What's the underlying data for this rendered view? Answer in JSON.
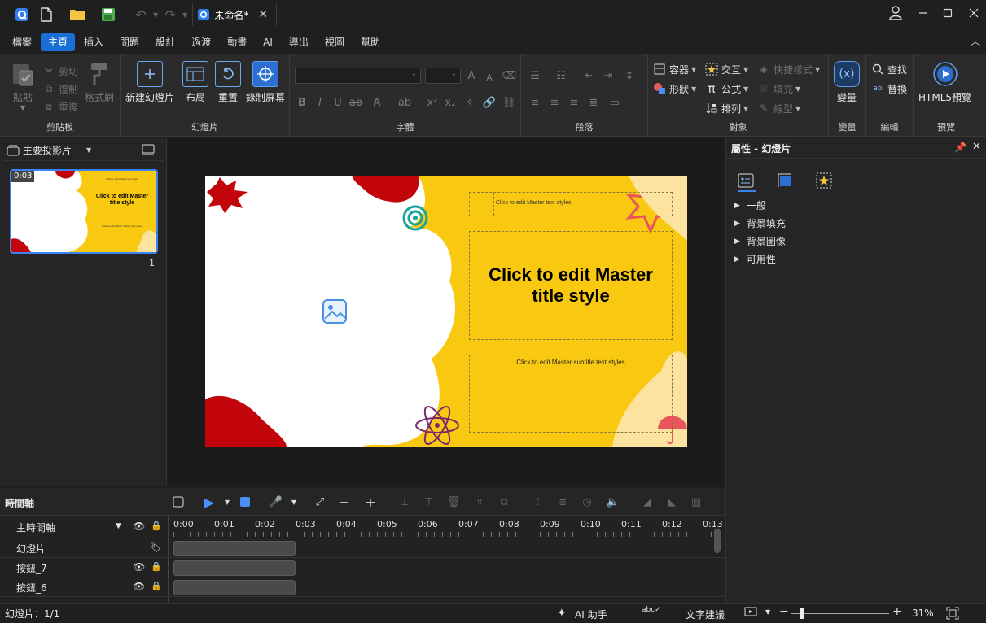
{
  "app": {
    "tab_title": "未命名*"
  },
  "menu": [
    "檔案",
    "主頁",
    "插入",
    "問題",
    "設計",
    "過渡",
    "動畫",
    "AI",
    "導出",
    "視圖",
    "幫助"
  ],
  "ribbon": {
    "clipboard": {
      "paste": "貼貼",
      "cut": "剪切",
      "copy": "復制",
      "redo": "重復",
      "format_painter": "格式刷",
      "label": "剪貼板"
    },
    "slides": {
      "new_slide": "新建幻燈片",
      "layout": "布局",
      "reset": "重置",
      "record_screen": "錄制屏幕",
      "label": "幻燈片"
    },
    "font": {
      "label": "字體"
    },
    "paragraph": {
      "label": "段落"
    },
    "object": {
      "container": "容器",
      "shape": "形狀",
      "interaction": "交互",
      "formula": "公式",
      "arrange": "排列",
      "quick_style": "快捷樣式",
      "fill": "填充",
      "line_type": "線型",
      "label": "對象"
    },
    "variable": {
      "variable": "變量",
      "label": "變量"
    },
    "edit": {
      "find": "查找",
      "replace": "替換",
      "label": "編輯"
    },
    "preview": {
      "html5_preview": "HTML5預覽",
      "label": "預覽"
    }
  },
  "left_panel": {
    "master_slide": "主要投影片",
    "thumb_duration": "0:03",
    "thumb_title": "Click to edit Master title style",
    "thumb_text": "Click to edit Master text styles",
    "thumb_subtitle": "Click to edit Master subtitle text styles",
    "thumb_number": "1"
  },
  "slide": {
    "text_styles": "Click to edit Master text styles",
    "title": "Click to edit Master title style",
    "subtitle": "Click to edit Master subtitle text styles"
  },
  "colors": {
    "accent": "#1a6fd6",
    "slide_bg": "#f9c912",
    "slide_red": "#c1050b",
    "selection": "#3b82f6"
  },
  "properties": {
    "title": "屬性 - 幻燈片",
    "sections": [
      "一般",
      "背景填充",
      "背景圖像",
      "可用性"
    ]
  },
  "timeline": {
    "title": "時間軸",
    "main": "主時間軸",
    "ticks": [
      "0:00",
      "0:01",
      "0:02",
      "0:03",
      "0:04",
      "0:05",
      "0:06",
      "0:07",
      "0:08",
      "0:09",
      "0:10",
      "0:11",
      "0:12",
      "0:13"
    ],
    "rows": [
      "幻燈片",
      "按鈕_7",
      "按鈕_6"
    ]
  },
  "status": {
    "slide_count": "幻燈片：1/1",
    "ai_assistant": "AI 助手",
    "text_suggestion": "文字建議",
    "zoom": "31%"
  }
}
